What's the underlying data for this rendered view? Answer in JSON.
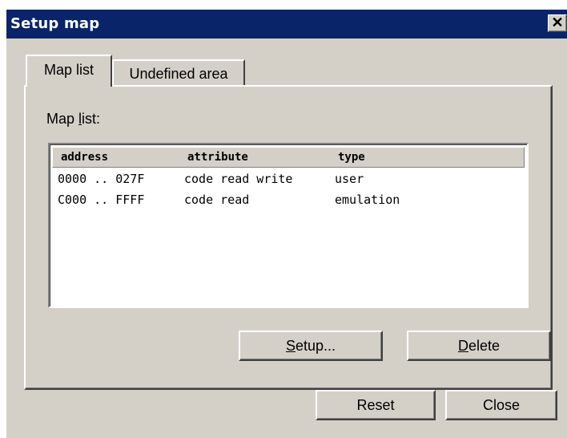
{
  "window": {
    "title": "Setup map",
    "close_glyph": "✕"
  },
  "tabs": [
    {
      "label": "Map list",
      "active": true
    },
    {
      "label": "Undefined area",
      "active": false
    }
  ],
  "map_list": {
    "group_label_prefix": "Map ",
    "group_label_mnemonic": "l",
    "group_label_suffix": "ist:",
    "columns": [
      "address",
      "attribute",
      "type"
    ],
    "rows": [
      {
        "address": "0000 .. 027F",
        "attribute": "code read write",
        "type": "user"
      },
      {
        "address": "C000 .. FFFF",
        "attribute": "code read",
        "type": "emulation"
      }
    ]
  },
  "buttons": {
    "setup": {
      "mnemonic": "S",
      "rest": "etup..."
    },
    "delete": {
      "mnemonic": "D",
      "rest": "elete"
    },
    "reset": "Reset",
    "close": "Close"
  }
}
